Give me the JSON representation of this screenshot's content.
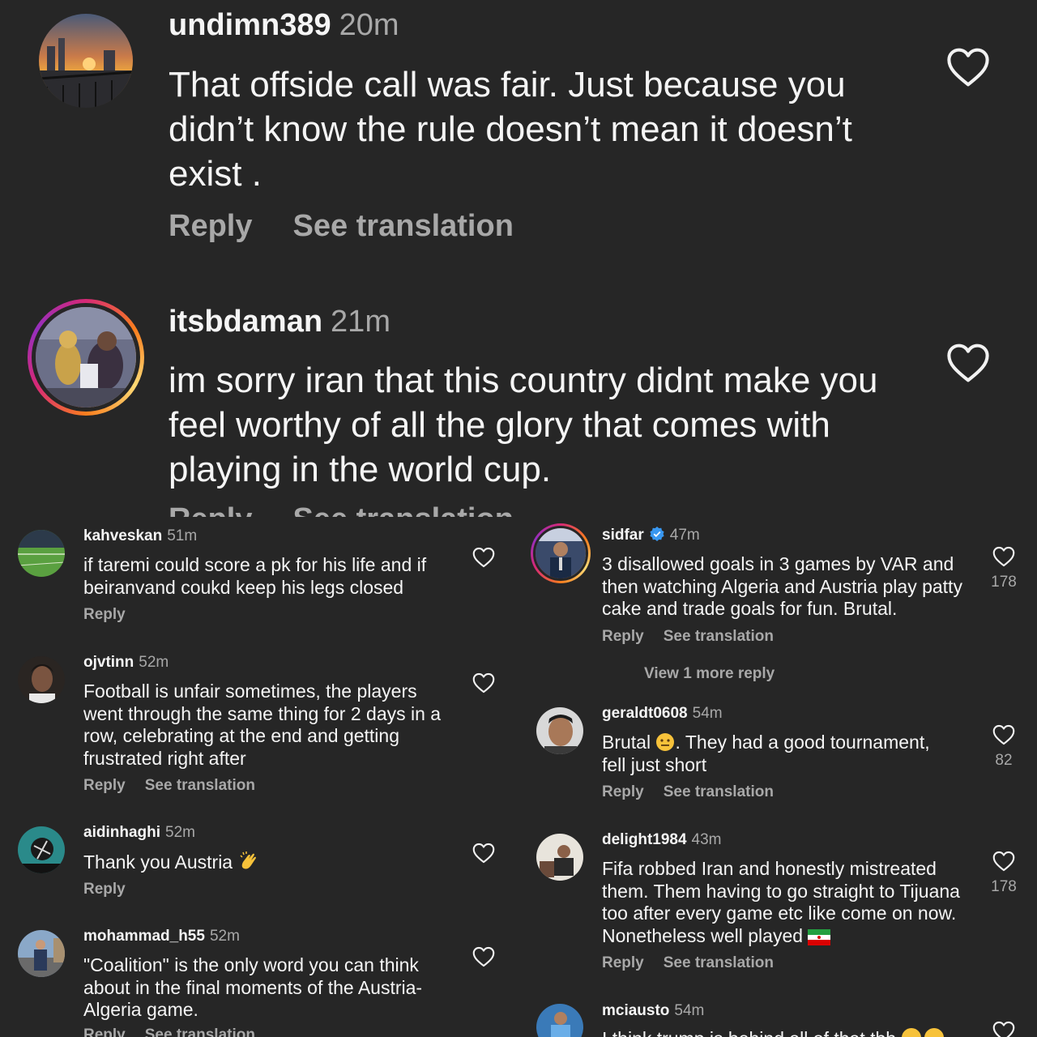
{
  "big_comments": [
    {
      "username": "undimn389",
      "time": "20m",
      "text": "That offside call was fair. Just because you didn’t know the rule doesn’t mean it doesn’t exist .",
      "reply": "Reply",
      "see_translation": "See translation"
    },
    {
      "username": "itsbdaman",
      "time": "21m",
      "text": "im sorry iran that this country didnt make you feel worthy of all the glory that comes with playing in the world cup.",
      "reply": "Reply",
      "see_translation": "See translation"
    }
  ],
  "left_comments": [
    {
      "username": "kahveskan",
      "time": "51m",
      "text": "if taremi could score a pk for his life and if beiranvand coukd keep his legs closed",
      "reply": "Reply"
    },
    {
      "username": "ojvtinn",
      "time": "52m",
      "text": "Football is unfair sometimes, the players went through the same thing for 2 days in a row, celebrating at the end and getting frustrated right after",
      "reply": "Reply",
      "see_translation": "See translation"
    },
    {
      "username": "aidinhaghi",
      "time": "52m",
      "text": "Thank you Austria",
      "emoji": "clapping-hands",
      "reply": "Reply"
    },
    {
      "username": "mohammad_h55",
      "time": "52m",
      "text": "\"Coalition\" is the only word you can think about in the final moments of the Austria-Algeria game.",
      "reply": "Reply",
      "see_translation": "See translation"
    }
  ],
  "right_comments": [
    {
      "username": "sidfar",
      "verified": true,
      "time": "47m",
      "text": "3 disallowed goals in 3 games by VAR and then watching Algeria and Austria play patty cake and trade goals for fun. Brutal.",
      "likes": "178",
      "reply": "Reply",
      "see_translation": "See translation",
      "view_more": "View 1 more reply"
    },
    {
      "username": "geraldt0608",
      "time": "54m",
      "text_before": "Brutal",
      "emoji": "neutral-face",
      "text_after": ". They had a good tournament, fell just short",
      "likes": "82",
      "reply": "Reply",
      "see_translation": "See translation"
    },
    {
      "username": "delight1984",
      "time": "43m",
      "text": "Fifa robbed Iran and honestly mistreated them. Them having to go straight to Tijuana too after every game etc like come on now. Nonetheless well played",
      "emoji": "iran-flag",
      "likes": "178",
      "reply": "Reply",
      "see_translation": "See translation"
    },
    {
      "username": "mciausto",
      "time": "54m",
      "text": "I think trump is behind all of that tbh",
      "emoji": "crying-laughing-faces"
    }
  ],
  "colors": {
    "background": "#262626",
    "text": "#f5f5f5",
    "secondary": "#a8a8a8",
    "verified": "#3897f0"
  }
}
